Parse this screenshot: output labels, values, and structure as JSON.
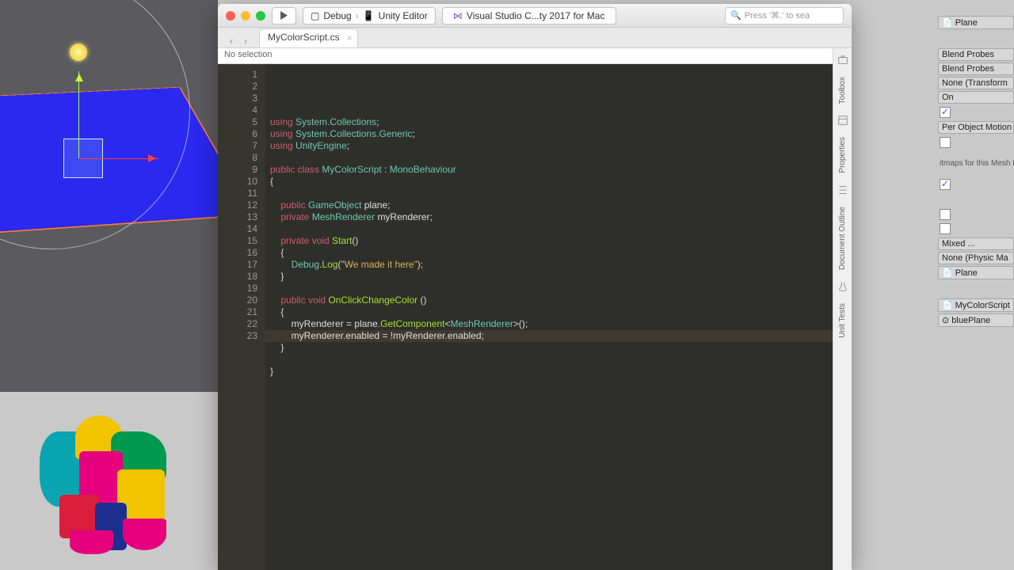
{
  "titlebar": {
    "run_config": "Debug",
    "run_target": "Unity Editor",
    "app_name": "Visual Studio C...ty 2017 for Mac",
    "search_placeholder": "Press '⌘.' to sea"
  },
  "tab": {
    "filename": "MyColorScript.cs"
  },
  "breadcrumb": "No selection",
  "right_rail": {
    "toolbox": "Toolbox",
    "properties": "Properties",
    "doc_outline": "Document Outline",
    "unit_tests": "Unit Tests"
  },
  "gutter_start": 1,
  "gutter_end": 23,
  "code_lines": [
    [
      [
        "kword",
        "using"
      ],
      [
        "pun",
        " "
      ],
      [
        "type",
        "System.Collections"
      ],
      [
        "pun",
        ";"
      ]
    ],
    [
      [
        "kword",
        "using"
      ],
      [
        "pun",
        " "
      ],
      [
        "type",
        "System.Collections.Generic"
      ],
      [
        "pun",
        ";"
      ]
    ],
    [
      [
        "kword",
        "using"
      ],
      [
        "pun",
        " "
      ],
      [
        "type",
        "UnityEngine"
      ],
      [
        "pun",
        ";"
      ]
    ],
    [],
    [
      [
        "kword",
        "public class"
      ],
      [
        "pun",
        " "
      ],
      [
        "type",
        "MyColorScript"
      ],
      [
        "pun",
        " : "
      ],
      [
        "type",
        "MonoBehaviour"
      ]
    ],
    [
      [
        "pun",
        "{"
      ]
    ],
    [],
    [
      [
        "pun",
        "    "
      ],
      [
        "kword",
        "public"
      ],
      [
        "pun",
        " "
      ],
      [
        "type",
        "GameObject"
      ],
      [
        "pun",
        " "
      ],
      [
        "ident",
        "plane"
      ],
      [
        "pun",
        ";"
      ]
    ],
    [
      [
        "pun",
        "    "
      ],
      [
        "kword",
        "private"
      ],
      [
        "pun",
        " "
      ],
      [
        "type",
        "MeshRenderer"
      ],
      [
        "pun",
        " "
      ],
      [
        "ident",
        "myRenderer"
      ],
      [
        "pun",
        ";"
      ]
    ],
    [],
    [
      [
        "pun",
        "    "
      ],
      [
        "kword",
        "private void"
      ],
      [
        "pun",
        " "
      ],
      [
        "func",
        "Start"
      ],
      [
        "pun",
        "()"
      ]
    ],
    [
      [
        "pun",
        "    {"
      ]
    ],
    [
      [
        "pun",
        "        "
      ],
      [
        "type",
        "Debug"
      ],
      [
        "pun",
        "."
      ],
      [
        "func",
        "Log"
      ],
      [
        "pun",
        "("
      ],
      [
        "str",
        "\"We made it here\""
      ],
      [
        "pun",
        ");"
      ]
    ],
    [
      [
        "pun",
        "    }"
      ]
    ],
    [],
    [
      [
        "pun",
        "    "
      ],
      [
        "kword",
        "public void"
      ],
      [
        "pun",
        " "
      ],
      [
        "func",
        "OnClickChangeColor"
      ],
      [
        "pun",
        " ()"
      ]
    ],
    [
      [
        "pun",
        "    {"
      ]
    ],
    [
      [
        "pun",
        "        "
      ],
      [
        "ident",
        "myRenderer"
      ],
      [
        "pun",
        " = "
      ],
      [
        "ident",
        "plane"
      ],
      [
        "pun",
        "."
      ],
      [
        "func",
        "GetComponent"
      ],
      [
        "pun",
        "<"
      ],
      [
        "type",
        "MeshRenderer"
      ],
      [
        "pun",
        ">();"
      ]
    ],
    [
      [
        "pun",
        "        "
      ],
      [
        "ident",
        "myRenderer"
      ],
      [
        "pun",
        "."
      ],
      [
        "ident",
        "enabled"
      ],
      [
        "pun",
        " = !"
      ],
      [
        "ident",
        "myRenderer"
      ],
      [
        "pun",
        "."
      ],
      [
        "ident",
        "enabled"
      ],
      [
        "pun",
        ";"
      ]
    ],
    [
      [
        "pun",
        "    }"
      ]
    ],
    [],
    [
      [
        "pun",
        "}"
      ]
    ],
    []
  ],
  "inspector": {
    "plane": "Plane",
    "blend1": "Blend Probes",
    "blend2": "Blend Probes",
    "anchor": "None (Transform",
    "on": "On",
    "motion": "Per Object Motion",
    "msg": "itmaps for this Mesh Renderer, please enable",
    "mixed": "Mixed ...",
    "physmat": "None (Physic Ma",
    "plane2": "Plane",
    "script": "MyColorScript",
    "bplane": "bluePlane"
  }
}
